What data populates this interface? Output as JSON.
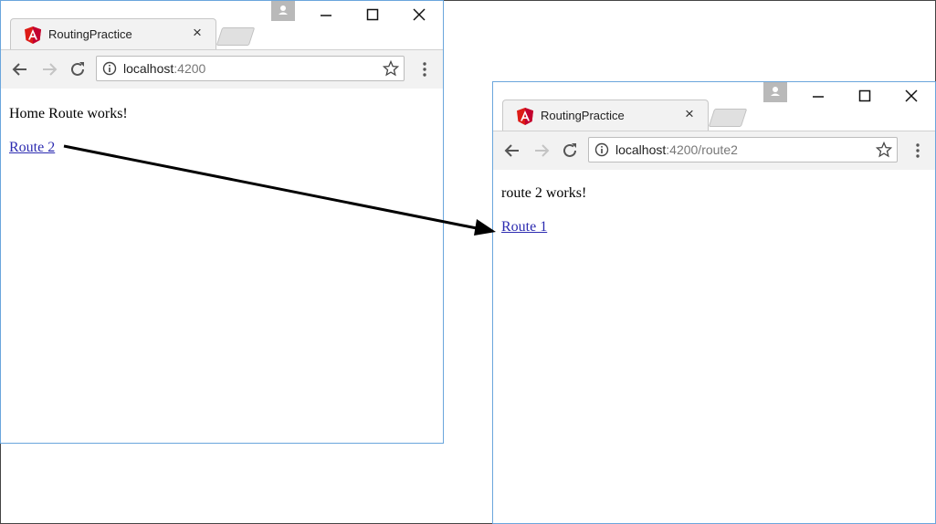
{
  "windows": [
    {
      "tab_title": "RoutingPractice",
      "url_host": "localhost",
      "url_rest": ":4200",
      "heading": "Home Route works!",
      "link": "Route 2"
    },
    {
      "tab_title": "RoutingPractice",
      "url_host": "localhost",
      "url_rest": ":4200/route2",
      "heading": "route 2 works!",
      "link": "Route 1"
    }
  ],
  "icons": {
    "tab_favicon": "angular-logo-icon",
    "tab_close": "close-icon",
    "profile": "person-icon",
    "minimize": "minimize-icon",
    "maximize": "maximize-icon",
    "close": "close-window-icon",
    "back": "arrow-left-icon",
    "forward": "arrow-right-icon",
    "reload": "reload-icon",
    "info": "info-icon",
    "bookmark": "star-icon",
    "menu": "kebab-menu-icon"
  },
  "colors": {
    "link": "#2c2bb0",
    "window_border": "#6aa6dc",
    "angular_red": "#dd1b16"
  }
}
